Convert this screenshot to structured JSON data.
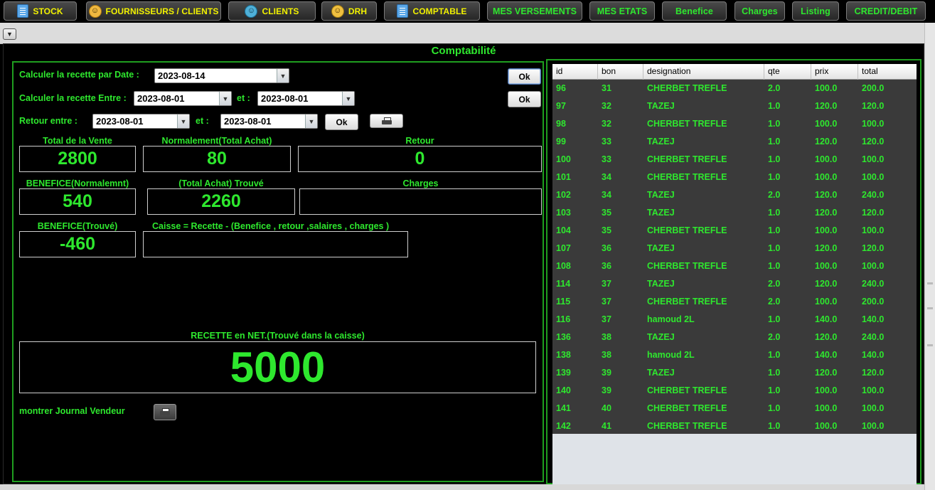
{
  "nav": {
    "buttons": [
      {
        "label": "STOCK",
        "icon": "document-icon",
        "color": "#f2f200"
      },
      {
        "label": "FOURNISSEURS / CLIENTS",
        "icon": "supplier-icon",
        "color": "#f2f200"
      },
      {
        "label": "CLIENTS",
        "icon": "client-icon",
        "color": "#f2f200"
      },
      {
        "label": "DRH",
        "icon": "hr-icon",
        "color": "#f2f200"
      },
      {
        "label": "COMPTABLE",
        "icon": "document-icon",
        "color": "#f2f200"
      },
      {
        "label": "MES VERSEMENTS",
        "color": "#2ee82e"
      },
      {
        "label": "MES ETATS",
        "color": "#2ee82e"
      },
      {
        "label": "Benefice",
        "color": "#2ee82e"
      },
      {
        "label": "Charges",
        "color": "#2ee82e"
      },
      {
        "label": "Listing",
        "color": "#2ee82e"
      },
      {
        "label": "CREDIT/DEBIT",
        "color": "#2ee82e"
      }
    ]
  },
  "panel_title": "Comptabilité",
  "form": {
    "by_date_label": "Calculer la recette par Date :",
    "by_date_value": "2023-08-14",
    "between_label": "Calculer la recette Entre :",
    "between_from": "2023-08-01",
    "et_label": "et :",
    "between_to": "2023-08-01",
    "retour_label": "Retour entre :",
    "retour_from": "2023-08-01",
    "retour_to": "2023-08-01",
    "ok_label": "Ok"
  },
  "stats": {
    "total_vente_label": "Total de la Vente",
    "total_vente": "2800",
    "total_achat_label": "Normalement(Total Achat)",
    "total_achat": "80",
    "retour_label": "Retour",
    "retour": "0",
    "benefice_norm_label": "BENEFICE(Normalemnt)",
    "benefice_norm": "540",
    "achat_trouve_label": "(Total Achat) Trouvé",
    "achat_trouve": "2260",
    "charges_label": "Charges",
    "charges": "",
    "benefice_trouve_label": "BENEFICE(Trouvé)",
    "benefice_trouve": "-460",
    "caisse_label": "Caisse = Recette - (Benefice , retour ,salaires , charges )",
    "caisse": "",
    "recette_net_label": "RECETTE en NET.(Trouvé dans la caisse)",
    "recette_net": "5000",
    "journal_label": "montrer Journal Vendeur"
  },
  "table": {
    "columns": [
      "id",
      "bon",
      "designation",
      "qte",
      "prix",
      "total"
    ],
    "rows": [
      [
        "96",
        "31",
        "CHERBET  TREFLE",
        "2.0",
        "100.0",
        "200.0"
      ],
      [
        "97",
        "32",
        "TAZEJ",
        "1.0",
        "120.0",
        "120.0"
      ],
      [
        "98",
        "32",
        "CHERBET  TREFLE",
        "1.0",
        "100.0",
        "100.0"
      ],
      [
        "99",
        "33",
        "TAZEJ",
        "1.0",
        "120.0",
        "120.0"
      ],
      [
        "100",
        "33",
        "CHERBET  TREFLE",
        "1.0",
        "100.0",
        "100.0"
      ],
      [
        "101",
        "34",
        "CHERBET  TREFLE",
        "1.0",
        "100.0",
        "100.0"
      ],
      [
        "102",
        "34",
        "TAZEJ",
        "2.0",
        "120.0",
        "240.0"
      ],
      [
        "103",
        "35",
        "TAZEJ",
        "1.0",
        "120.0",
        "120.0"
      ],
      [
        "104",
        "35",
        "CHERBET  TREFLE",
        "1.0",
        "100.0",
        "100.0"
      ],
      [
        "107",
        "36",
        "TAZEJ",
        "1.0",
        "120.0",
        "120.0"
      ],
      [
        "108",
        "36",
        "CHERBET  TREFLE",
        "1.0",
        "100.0",
        "100.0"
      ],
      [
        "114",
        "37",
        "TAZEJ",
        "2.0",
        "120.0",
        "240.0"
      ],
      [
        "115",
        "37",
        "CHERBET  TREFLE",
        "2.0",
        "100.0",
        "200.0"
      ],
      [
        "116",
        "37",
        "hamoud 2L",
        "1.0",
        "140.0",
        "140.0"
      ],
      [
        "136",
        "38",
        "TAZEJ",
        "2.0",
        "120.0",
        "240.0"
      ],
      [
        "138",
        "38",
        "hamoud 2L",
        "1.0",
        "140.0",
        "140.0"
      ],
      [
        "139",
        "39",
        "TAZEJ",
        "1.0",
        "120.0",
        "120.0"
      ],
      [
        "140",
        "39",
        "CHERBET  TREFLE",
        "1.0",
        "100.0",
        "100.0"
      ],
      [
        "141",
        "40",
        "CHERBET  TREFLE",
        "1.0",
        "100.0",
        "100.0"
      ],
      [
        "142",
        "41",
        "CHERBET  TREFLE",
        "1.0",
        "100.0",
        "100.0"
      ]
    ]
  },
  "colors": {
    "accent_green": "#2ee82e",
    "nav_yellow": "#f2f200",
    "frame_green": "#1f9e1f"
  }
}
